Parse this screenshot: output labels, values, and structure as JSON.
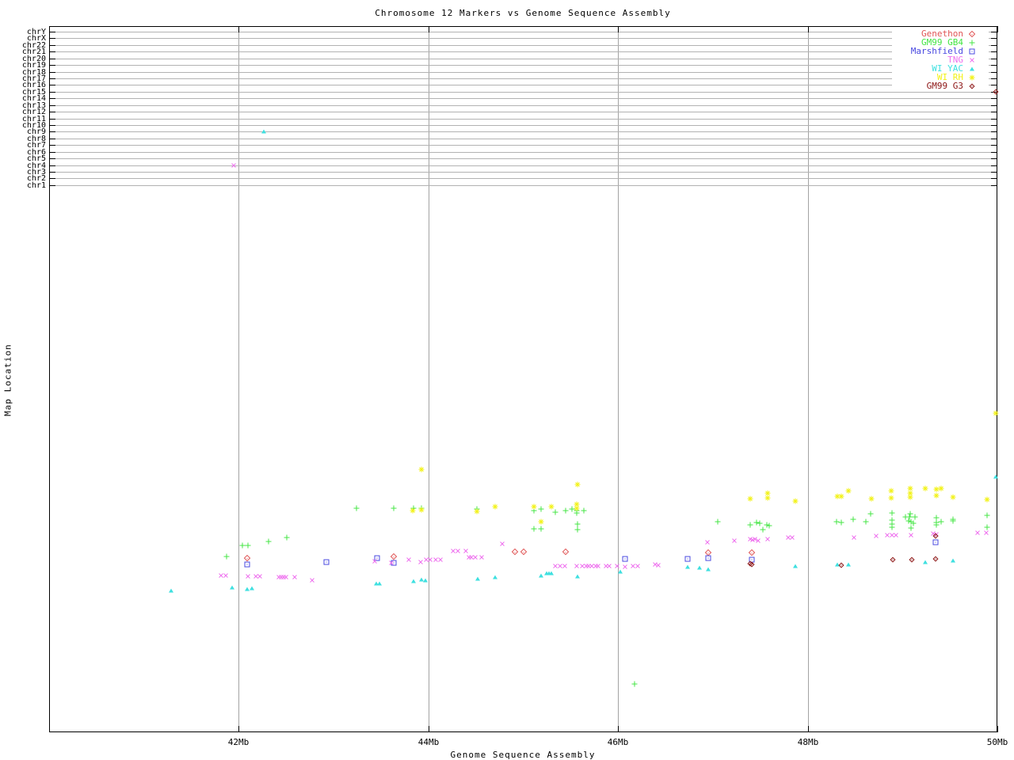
{
  "title": "Chromosome 12 Markers vs Genome Sequence Assembly",
  "axes": {
    "x_label": "Genome Sequence Assembly",
    "y_label": "Map Location",
    "x_tick_labels": [
      "42Mb",
      "44Mb",
      "46Mb",
      "48Mb",
      "50Mb"
    ],
    "x_tick_mb": [
      42,
      44,
      46,
      48,
      50
    ],
    "x_range_mb": [
      40,
      50
    ]
  },
  "chromosome_rows": [
    "chrY",
    "chrX",
    "chr22",
    "chr21",
    "chr20",
    "chr19",
    "chr18",
    "chr17",
    "chr16",
    "chr15",
    "chr14",
    "chr13",
    "chr12",
    "chr11",
    "chr10",
    "chr9",
    "chr8",
    "chr7",
    "chr6",
    "chr5",
    "chr4",
    "chr3",
    "chr2",
    "chr1"
  ],
  "chart_data": {
    "type": "scatter",
    "title": "Chromosome 12 Markers vs Genome Sequence Assembly",
    "xlabel": "Genome Sequence Assembly",
    "ylabel": "Map Location",
    "x_unit": "Mb",
    "x_range": [
      40,
      50
    ],
    "grid": "on",
    "legend_position": "top-right",
    "note": "Top band shows one gridline row per chromosome (chrY..chr1); markers there mark hits on other chromosomes. Main area y-scale (Map Location) is unlabeled, so point y values are given as original screen pixel rows (plot top=33, bottom=925). x values in Mb.",
    "series": [
      {
        "name": "Genethon",
        "marker": "open-diamond",
        "color": "#e05555",
        "points": [
          [
            42.09,
            705
          ],
          [
            43.63,
            703
          ],
          [
            44.91,
            697
          ],
          [
            45.0,
            697
          ],
          [
            45.45,
            697
          ],
          [
            46.95,
            698
          ],
          [
            47.41,
            698
          ]
        ]
      },
      {
        "name": "GM99 GB4",
        "marker": "plus",
        "color": "#44e544",
        "points": [
          [
            41.87,
            703
          ],
          [
            42.04,
            689
          ],
          [
            42.1,
            689
          ],
          [
            42.31,
            684
          ],
          [
            42.51,
            679
          ],
          [
            43.24,
            642
          ],
          [
            43.63,
            642
          ],
          [
            43.84,
            642
          ],
          [
            43.93,
            642
          ],
          [
            44.51,
            643
          ],
          [
            45.11,
            645
          ],
          [
            45.19,
            643
          ],
          [
            45.34,
            647
          ],
          [
            45.45,
            645
          ],
          [
            45.51,
            643
          ],
          [
            45.56,
            645
          ],
          [
            45.56,
            648
          ],
          [
            45.64,
            645
          ],
          [
            45.11,
            668
          ],
          [
            45.19,
            668
          ],
          [
            45.57,
            662
          ],
          [
            45.57,
            669
          ],
          [
            46.17,
            864
          ],
          [
            47.05,
            659
          ],
          [
            47.39,
            663
          ],
          [
            47.46,
            660
          ],
          [
            47.49,
            661
          ],
          [
            47.53,
            669
          ],
          [
            47.57,
            663
          ],
          [
            47.59,
            664
          ],
          [
            48.3,
            659
          ],
          [
            48.35,
            660
          ],
          [
            48.48,
            656
          ],
          [
            48.61,
            659
          ],
          [
            48.66,
            649
          ],
          [
            48.89,
            648
          ],
          [
            48.89,
            657
          ],
          [
            48.89,
            662
          ],
          [
            48.89,
            666
          ],
          [
            49.03,
            653
          ],
          [
            49.07,
            653
          ],
          [
            49.08,
            649
          ],
          [
            49.06,
            658
          ],
          [
            49.09,
            659
          ],
          [
            49.11,
            661
          ],
          [
            49.13,
            653
          ],
          [
            49.09,
            667
          ],
          [
            49.36,
            654
          ],
          [
            49.36,
            660
          ],
          [
            49.36,
            663
          ],
          [
            49.41,
            659
          ],
          [
            49.53,
            656
          ],
          [
            49.53,
            658
          ],
          [
            49.89,
            651
          ],
          [
            49.89,
            666
          ]
        ]
      },
      {
        "name": "Marshfield",
        "marker": "open-square",
        "color": "#4848e0",
        "points": [
          [
            42.09,
            713
          ],
          [
            42.92,
            710
          ],
          [
            43.46,
            705
          ],
          [
            43.63,
            711
          ],
          [
            46.07,
            706
          ],
          [
            46.73,
            706
          ],
          [
            46.95,
            705
          ],
          [
            47.41,
            707
          ],
          [
            49.35,
            685
          ]
        ]
      },
      {
        "name": "TNG",
        "marker": "cross",
        "color": "#ee70ee",
        "points": [
          [
            41.81,
            727
          ],
          [
            41.86,
            727
          ],
          [
            42.1,
            728
          ],
          [
            42.18,
            728
          ],
          [
            42.22,
            728
          ],
          [
            42.42,
            729
          ],
          [
            42.45,
            729
          ],
          [
            42.47,
            729
          ],
          [
            42.5,
            729
          ],
          [
            42.59,
            729
          ],
          [
            42.77,
            733
          ],
          [
            43.43,
            709
          ],
          [
            43.61,
            711
          ],
          [
            43.79,
            707
          ],
          [
            43.92,
            710
          ],
          [
            43.98,
            707
          ],
          [
            44.02,
            707
          ],
          [
            44.08,
            707
          ],
          [
            44.13,
            707
          ],
          [
            44.26,
            696
          ],
          [
            44.31,
            696
          ],
          [
            44.39,
            696
          ],
          [
            44.43,
            704
          ],
          [
            44.45,
            704
          ],
          [
            44.49,
            704
          ],
          [
            44.56,
            704
          ],
          [
            44.78,
            687
          ],
          [
            45.34,
            715
          ],
          [
            45.39,
            715
          ],
          [
            45.44,
            715
          ],
          [
            45.56,
            715
          ],
          [
            45.62,
            715
          ],
          [
            45.66,
            715
          ],
          [
            45.69,
            715
          ],
          [
            45.72,
            715
          ],
          [
            45.76,
            715
          ],
          [
            45.79,
            715
          ],
          [
            45.87,
            715
          ],
          [
            45.91,
            715
          ],
          [
            45.99,
            715
          ],
          [
            46.07,
            716
          ],
          [
            46.16,
            715
          ],
          [
            46.21,
            715
          ],
          [
            46.39,
            713
          ],
          [
            46.42,
            714
          ],
          [
            46.94,
            685
          ],
          [
            47.23,
            683
          ],
          [
            47.39,
            681
          ],
          [
            47.42,
            682
          ],
          [
            47.44,
            681
          ],
          [
            47.48,
            683
          ],
          [
            47.58,
            681
          ],
          [
            47.79,
            679
          ],
          [
            47.84,
            679
          ],
          [
            48.49,
            679
          ],
          [
            48.72,
            677
          ],
          [
            48.84,
            676
          ],
          [
            48.89,
            676
          ],
          [
            48.93,
            676
          ],
          [
            49.09,
            676
          ],
          [
            49.32,
            674
          ],
          [
            49.36,
            675
          ],
          [
            49.79,
            673
          ],
          [
            49.88,
            673
          ]
        ]
      },
      {
        "name": "WI YAC",
        "marker": "triangle",
        "color": "#3fe0e0",
        "points": [
          [
            41.29,
            746
          ],
          [
            41.93,
            742
          ],
          [
            42.09,
            744
          ],
          [
            42.14,
            743
          ],
          [
            43.45,
            737
          ],
          [
            43.48,
            737
          ],
          [
            43.84,
            734
          ],
          [
            43.93,
            732
          ],
          [
            43.97,
            733
          ],
          [
            44.52,
            731
          ],
          [
            44.7,
            729
          ],
          [
            45.19,
            727
          ],
          [
            45.25,
            724
          ],
          [
            45.27,
            724
          ],
          [
            45.3,
            724
          ],
          [
            45.57,
            728
          ],
          [
            46.02,
            722
          ],
          [
            46.73,
            716
          ],
          [
            46.86,
            717
          ],
          [
            46.95,
            719
          ],
          [
            47.87,
            715
          ],
          [
            48.31,
            713
          ],
          [
            48.43,
            713
          ],
          [
            49.24,
            710
          ],
          [
            49.53,
            708
          ],
          [
            49.98,
            602
          ]
        ]
      },
      {
        "name": "WI RH",
        "marker": "star",
        "color": "#f2f218",
        "points": [
          [
            43.93,
            593
          ],
          [
            43.83,
            645
          ],
          [
            43.93,
            644
          ],
          [
            44.51,
            646
          ],
          [
            44.7,
            640
          ],
          [
            45.11,
            640
          ],
          [
            45.3,
            640
          ],
          [
            45.57,
            612
          ],
          [
            45.56,
            637
          ],
          [
            45.56,
            642
          ],
          [
            45.19,
            659
          ],
          [
            47.39,
            630
          ],
          [
            47.58,
            623
          ],
          [
            47.58,
            629
          ],
          [
            47.87,
            633
          ],
          [
            48.31,
            627
          ],
          [
            48.35,
            627
          ],
          [
            48.43,
            620
          ],
          [
            48.67,
            630
          ],
          [
            48.88,
            620
          ],
          [
            48.88,
            629
          ],
          [
            49.08,
            617
          ],
          [
            49.08,
            623
          ],
          [
            49.08,
            628
          ],
          [
            49.24,
            617
          ],
          [
            49.36,
            618
          ],
          [
            49.36,
            626
          ],
          [
            49.41,
            617
          ],
          [
            49.53,
            628
          ],
          [
            49.89,
            631
          ],
          [
            49.98,
            522
          ]
        ]
      },
      {
        "name": "GM99 G3",
        "marker": "small-diamond",
        "color": "#8c1414",
        "points": [
          [
            47.39,
            712
          ],
          [
            47.41,
            713
          ],
          [
            48.35,
            714
          ],
          [
            48.9,
            707
          ],
          [
            49.1,
            707
          ],
          [
            49.35,
            706
          ],
          [
            49.35,
            677
          ]
        ]
      }
    ],
    "chromosome_band_points": [
      {
        "series": "TNG",
        "chrom": "chr4",
        "x_mb": 41.95
      },
      {
        "series": "WI YAC",
        "chrom": "chr9",
        "x_mb": 42.26
      },
      {
        "series": "GM99 G3",
        "chrom": "chr15",
        "x_mb": 49.98
      }
    ]
  }
}
